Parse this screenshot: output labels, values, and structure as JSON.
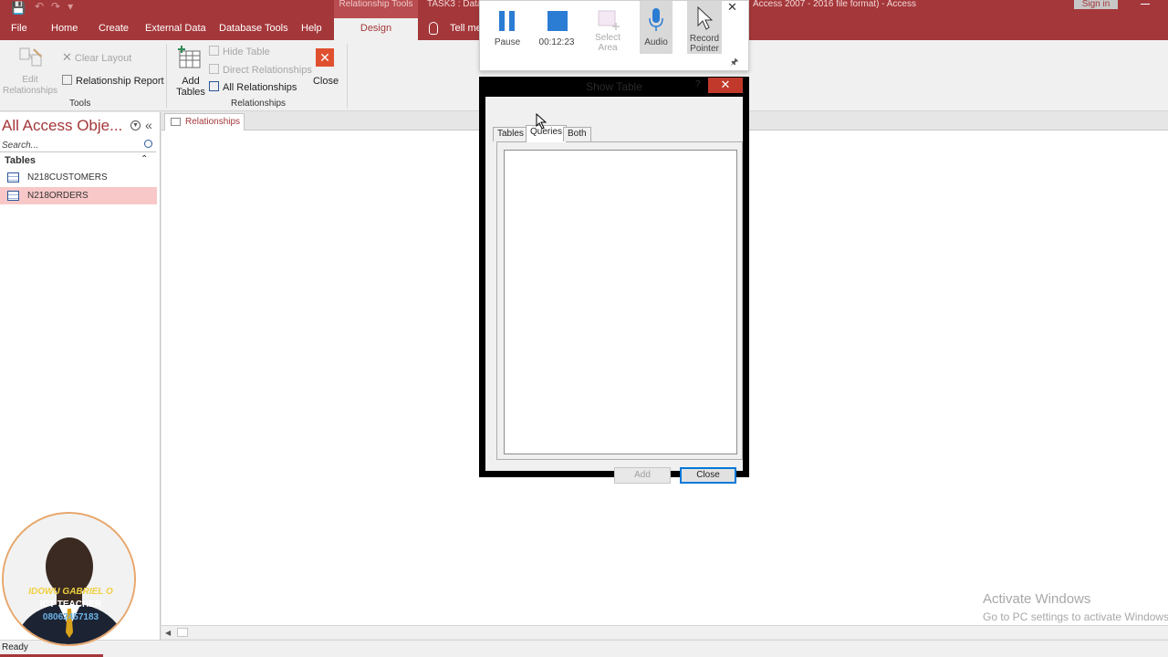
{
  "window": {
    "context_tab_group": "Relationship Tools",
    "doc_title_left": "TASK3 : Data",
    "doc_title_right": "Access 2007 - 2016 file format) - Access",
    "sign_in": "Sign in"
  },
  "tabs": [
    {
      "label": "File"
    },
    {
      "label": "Home"
    },
    {
      "label": "Create"
    },
    {
      "label": "External Data"
    },
    {
      "label": "Database Tools"
    },
    {
      "label": "Help"
    },
    {
      "label": "Design"
    },
    {
      "label": "Tell me"
    }
  ],
  "ribbon": {
    "tools": {
      "edit_relationships": "Edit Relationships",
      "clear_layout": "Clear Layout",
      "relationship_report": "Relationship Report",
      "group_label": "Tools"
    },
    "relationships": {
      "add_tables_line1": "Add",
      "add_tables_line2": "Tables",
      "hide_table": "Hide Table",
      "direct_relationships": "Direct Relationships",
      "all_relationships": "All Relationships",
      "close": "Close",
      "group_label": "Relationships"
    }
  },
  "nav": {
    "title": "All Access Obje...",
    "search_placeholder": "Search...",
    "group": "Tables",
    "items": [
      {
        "label": "N218CUSTOMERS",
        "selected": false
      },
      {
        "label": "N218ORDERS",
        "selected": true
      }
    ]
  },
  "document": {
    "tab_label": "Relationships"
  },
  "recorder": {
    "pause": "Pause",
    "timer": "00:12:23",
    "select_area_line1": "Select",
    "select_area_line2": "Area",
    "audio": "Audio",
    "record_pointer_line1": "Record",
    "record_pointer_line2": "Pointer"
  },
  "dialog": {
    "title": "Show Table",
    "help": "?",
    "tabs": [
      {
        "label": "Tables"
      },
      {
        "label": "Queries",
        "active": true
      },
      {
        "label": "Both"
      }
    ],
    "add_button": "Add",
    "close_button": "Close"
  },
  "status": {
    "text": "Ready"
  },
  "watermark": {
    "line1": "Activate Windows",
    "line2": "Go to PC settings to activate Windows."
  },
  "webcam": {
    "name": "IDOWU GABRIEL O",
    "role": "ICT TEACHER",
    "phone": "08062457183"
  },
  "colors": {
    "accent": "#a4373a",
    "selected_row": "#f8c8c8",
    "dialog_close": "#c1392b",
    "recorder_blue": "#2b7cd3"
  }
}
